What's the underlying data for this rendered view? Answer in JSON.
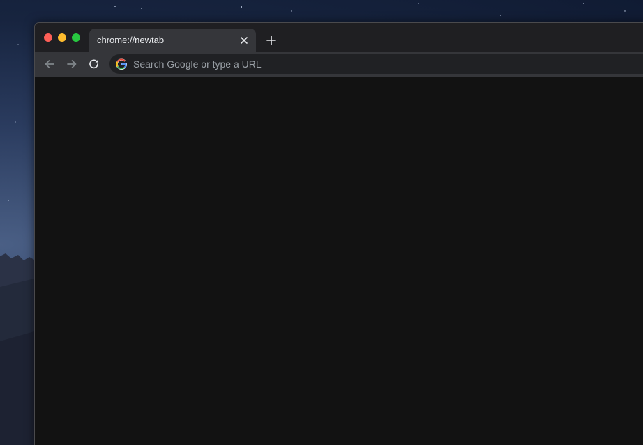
{
  "window": {
    "traffic_lights": [
      "close",
      "minimize",
      "zoom"
    ]
  },
  "tab": {
    "title": "chrome://newtab",
    "close_icon": "close-icon",
    "new_tab_icon": "plus-icon"
  },
  "toolbar": {
    "back_icon": "arrow-left-icon",
    "forward_icon": "arrow-right-icon",
    "reload_icon": "reload-icon"
  },
  "omnibox": {
    "placeholder": "Search Google or type a URL",
    "icon": "google-g-icon"
  },
  "colors": {
    "tab_strip": "#1f1f22",
    "toolbar": "#35363a",
    "omnibox": "#202124",
    "content": "#121212",
    "traffic_close": "#fe5f57",
    "traffic_minimize": "#febc2e",
    "traffic_zoom": "#28c840"
  }
}
